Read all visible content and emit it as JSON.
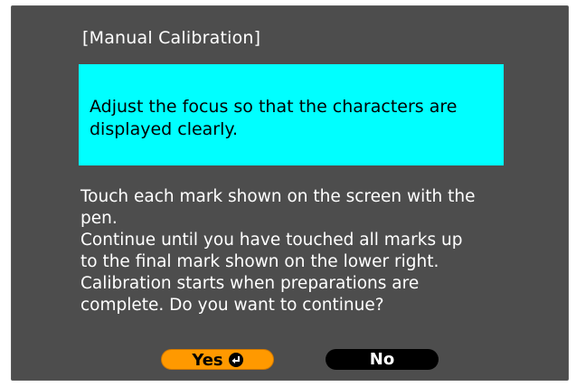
{
  "dialog": {
    "title": "[Manual Calibration]",
    "notice_lines": [
      "Adjust the focus so that the characters are",
      "displayed clearly."
    ],
    "body_lines": [
      "Touch each mark shown on the screen with the",
      "pen.",
      "Continue until you have touched all marks up",
      "to the final mark shown on the lower right.",
      "Calibration starts when preparations are",
      "complete. Do you want to continue?"
    ],
    "buttons": {
      "yes_label": "Yes",
      "no_label": "No"
    }
  },
  "colors": {
    "background": "#4d4d4d",
    "notice": "#00ffff",
    "yes_button": "#ff9900",
    "no_button": "#000000"
  },
  "icons": {
    "yes_button_icon": "enter-icon"
  }
}
